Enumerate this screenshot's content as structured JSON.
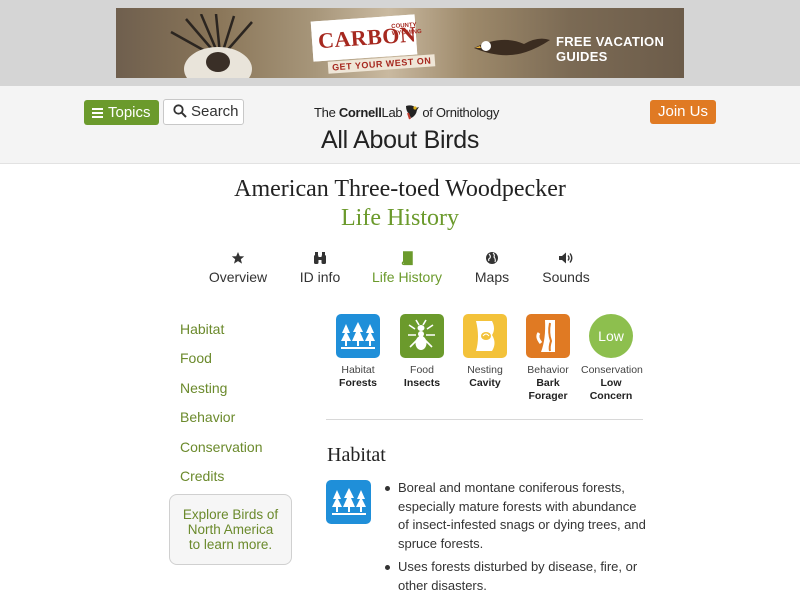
{
  "ad": {
    "brand": "CARBON",
    "county_line": "COUNTY WYOMING",
    "tagline": "GET YOUR WEST ON",
    "cta": "FREE VACATION GUIDES"
  },
  "header": {
    "topics_label": "Topics",
    "search_label": "Search",
    "logo": {
      "pre": "The ",
      "bold": "Cornell",
      "mid": "Lab",
      "post": "of Ornithology"
    },
    "site_title": "All About Birds",
    "join_label": "Join Us",
    "colors": {
      "green": "#6b9a2c",
      "orange": "#e07a23"
    }
  },
  "species": {
    "name": "American Three-toed Woodpecker",
    "page": "Life History"
  },
  "tabs": [
    {
      "label": "Overview",
      "icon": "star-icon"
    },
    {
      "label": "ID info",
      "icon": "binoculars-icon"
    },
    {
      "label": "Life History",
      "icon": "book-icon",
      "active": true
    },
    {
      "label": "Maps",
      "icon": "globe-icon"
    },
    {
      "label": "Sounds",
      "icon": "speaker-icon"
    }
  ],
  "sidebar": {
    "links": [
      "Habitat",
      "Food",
      "Nesting",
      "Behavior",
      "Conservation",
      "Credits"
    ],
    "explore": [
      "Explore Birds of",
      "North America",
      "to learn more."
    ]
  },
  "quick_facts": [
    {
      "category": "Habitat",
      "value": "Forests",
      "icon": "forest-icon",
      "color": "#1f8fd9"
    },
    {
      "category": "Food",
      "value": "Insects",
      "icon": "insect-icon",
      "color": "#6b9a2c"
    },
    {
      "category": "Nesting",
      "value": "Cavity",
      "icon": "cavity-icon",
      "color": "#f3c23a"
    },
    {
      "category": "Behavior",
      "value": "Bark Forager",
      "icon": "bark-icon",
      "color": "#e07a23"
    },
    {
      "category": "Conservation",
      "value": "Low Concern",
      "badge": "Low",
      "color": "#8dbf4e"
    }
  ],
  "habitat": {
    "heading": "Habitat",
    "bullets": [
      "Boreal and montane coniferous forests, especially mature forests with abundance of insect-infested snags or dying trees, and spruce forests.",
      "Uses forests disturbed by disease, fire, or other disasters."
    ]
  }
}
